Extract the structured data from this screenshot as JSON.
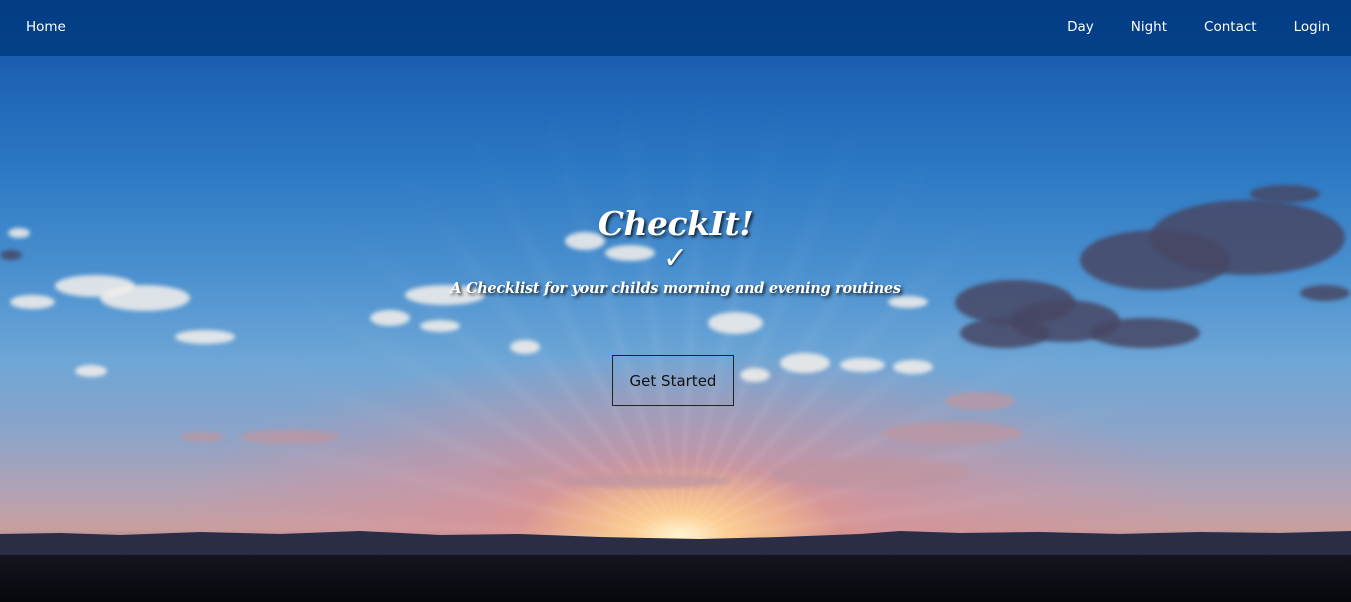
{
  "navbar": {
    "home_label": "Home",
    "links": [
      {
        "label": "Day"
      },
      {
        "label": "Night"
      },
      {
        "label": "Contact"
      },
      {
        "label": "Login"
      }
    ],
    "background": "#003a80"
  },
  "hero": {
    "brand_title": "CheckIt!",
    "check_mark": "✓",
    "tagline": "A Checklist for your childs morning and evening routines",
    "cta_label": "Get Started",
    "background_image": "sunset-sky"
  }
}
